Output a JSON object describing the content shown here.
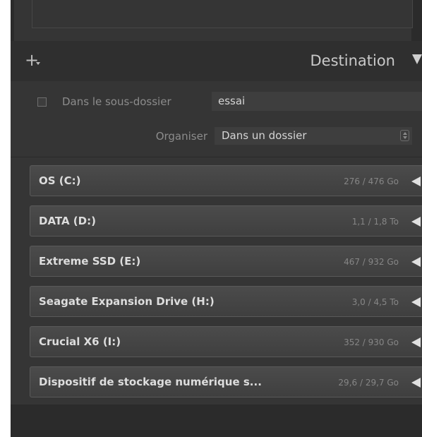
{
  "header": {
    "title": "Destination"
  },
  "subfolder": {
    "label": "Dans le sous-dossier",
    "value": "essai",
    "checked": false
  },
  "organize": {
    "label": "Organiser",
    "selected": "Dans un dossier"
  },
  "drives": [
    {
      "name": "OS (C:)",
      "size": "276 / 476 Go"
    },
    {
      "name": "DATA (D:)",
      "size": "1,1 / 1,8 To"
    },
    {
      "name": "Extreme SSD (E:)",
      "size": "467 / 932 Go"
    },
    {
      "name": "Seagate Expansion Drive (H:)",
      "size": "3,0 / 4,5 To"
    },
    {
      "name": "Crucial X6 (I:)",
      "size": "352 / 930 Go"
    },
    {
      "name": "Dispositif de stockage numérique s...",
      "size": "29,6 / 29,7 Go"
    }
  ],
  "icons": {
    "add": "plus-icon",
    "collapse": "triangle-down-icon",
    "eject": "triangle-left-icon",
    "stepper": "up-down-icon"
  },
  "colors": {
    "panel": "#353535",
    "header": "#2f2f2f",
    "drive_row": "#474747",
    "text": "#dddddd",
    "muted_text": "#868686"
  }
}
